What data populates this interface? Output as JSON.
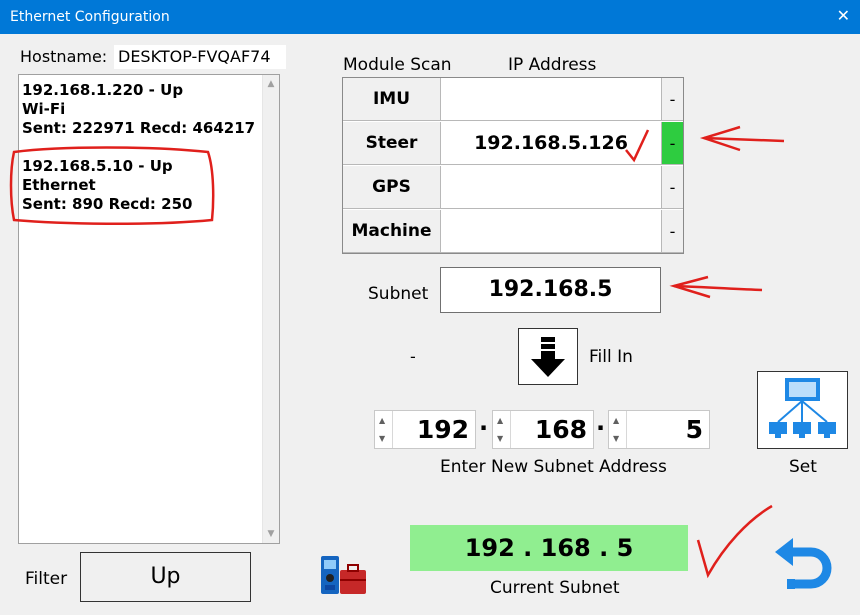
{
  "window": {
    "title": "Ethernet Configuration",
    "close_glyph": "✕"
  },
  "hostname": {
    "label": "Hostname:",
    "value": "DESKTOP-FVQAF74"
  },
  "interfaces": [
    {
      "line1": "192.168.1.220  - Up",
      "line2": "Wi-Fi",
      "line3": "Sent: 222971   Recd: 464217"
    },
    {
      "line1": "192.168.5.10  - Up",
      "line2": "Ethernet",
      "line3": "Sent: 890   Recd: 250"
    }
  ],
  "modules": {
    "header_scan": "Module Scan",
    "header_ip": "IP Address",
    "rows": [
      {
        "name": "IMU",
        "ip": "",
        "status": "-"
      },
      {
        "name": "Steer",
        "ip": "192.168.5.126",
        "status": "-"
      },
      {
        "name": "GPS",
        "ip": "",
        "status": "-"
      },
      {
        "name": "Machine",
        "ip": "",
        "status": "-"
      }
    ]
  },
  "subnet": {
    "label": "Subnet",
    "value": "192.168.5"
  },
  "fill": {
    "dash": "-",
    "label": "Fill In"
  },
  "new_subnet": {
    "octets": [
      "192",
      "168",
      "5"
    ],
    "separator": "·",
    "label": "Enter New Subnet Address"
  },
  "set": {
    "label": "Set"
  },
  "current_subnet": {
    "value": "192 . 168 . 5",
    "label": "Current Subnet"
  },
  "filter": {
    "label": "Filter",
    "button": "Up"
  },
  "colors": {
    "titlebar": "#0078d7",
    "status_active": "#2ecc40",
    "current_subnet_bg": "#90ee90",
    "annotation_ink": "#e0201c",
    "icon_blue": "#1e88e5"
  }
}
